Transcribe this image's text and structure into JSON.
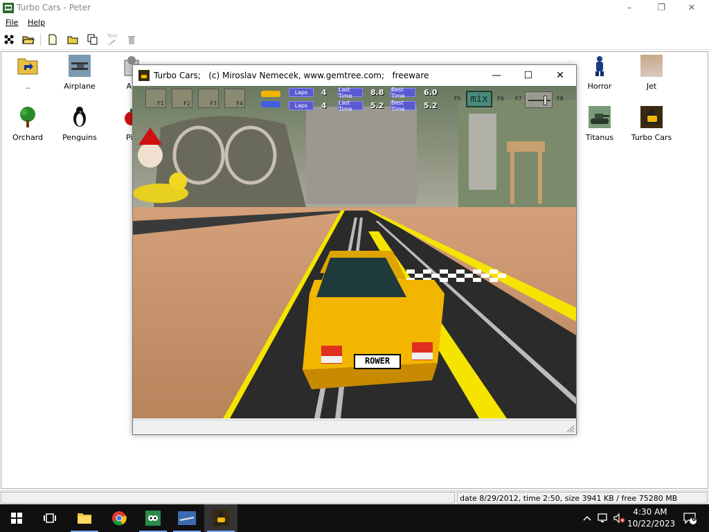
{
  "window": {
    "title": "Turbo Cars - Peter",
    "controls": {
      "minimize": "–",
      "maximize": "❐",
      "close": "✕"
    }
  },
  "menu": [
    {
      "label": "File"
    },
    {
      "label": "Help"
    }
  ],
  "toolbar": {
    "text_button_label": "Text"
  },
  "items": [
    {
      "label": "..",
      "icon": "folder-up-icon"
    },
    {
      "label": "Airplane",
      "icon": "airplane-icon"
    },
    {
      "label": "Alt",
      "icon": "alt-icon"
    },
    {
      "label": "Horror",
      "icon": "horror-icon"
    },
    {
      "label": "Jet",
      "icon": "jet-icon"
    },
    {
      "label": "Orchard",
      "icon": "tree-icon"
    },
    {
      "label": "Penguins",
      "icon": "penguin-icon"
    },
    {
      "label": "Pie",
      "icon": "pie-icon"
    },
    {
      "label": "Titanus",
      "icon": "tank-icon"
    },
    {
      "label": "Turbo Cars",
      "icon": "turbo-cars-icon"
    }
  ],
  "status": {
    "info": "date 8/29/2012, time 2:50, size 3941 KB / free 75280 MB"
  },
  "game": {
    "title": "Turbo Cars;   (c) Miroslav Nemecek, www.gemtree.com;   freeware",
    "controls": {
      "minimize": "—",
      "maximize": "☐",
      "close": "✕"
    },
    "hud": {
      "buttons": [
        "F1",
        "F2",
        "F3",
        "F4"
      ],
      "laps_label": "Laps",
      "last_time_label": "Last Time",
      "best_time_label": "Best Time",
      "player1": {
        "laps": "4",
        "last_time": "8.8",
        "best_time": "6.0"
      },
      "player2": {
        "laps": "4",
        "last_time": "5.2",
        "best_time": "5.2"
      },
      "f5": "F5",
      "mix": "mix",
      "f6": "F6",
      "f7": "F7",
      "f8": "F8"
    },
    "license_plate": "ROWER"
  },
  "taskbar": {
    "time": "4:30 AM",
    "date": "10/22/2023",
    "notification_count": "6"
  },
  "colors": {
    "car": "#f2b600",
    "track": "#2b2b2b",
    "lane_line": "#f5e400",
    "floor": "#c9936a",
    "hud_label": "#5a5ad0"
  }
}
